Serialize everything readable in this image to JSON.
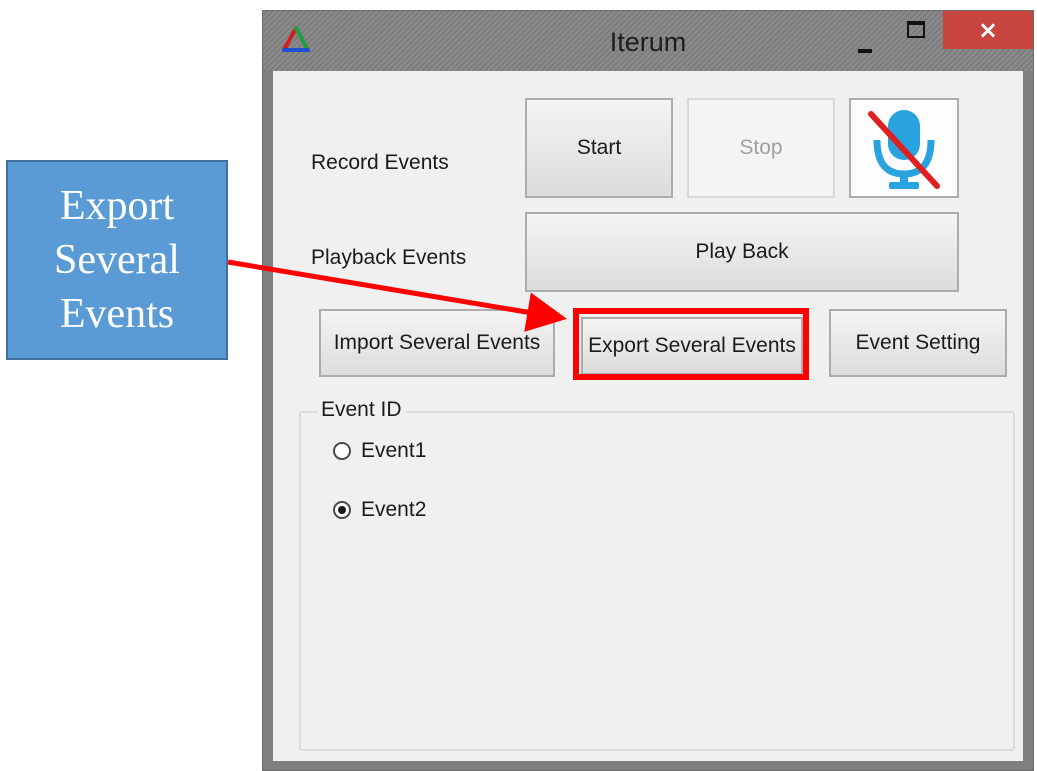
{
  "window": {
    "title": "Iterum",
    "close_glyph": "×"
  },
  "form": {
    "record_label": "Record Events",
    "playback_label": "Playback Events",
    "start_button": "Start",
    "stop_button": "Stop",
    "mic_button_icon": "microphone-muted-icon",
    "play_back_button": "Play Back",
    "import_button": "Import Several Events",
    "export_button": "Export Several Events",
    "event_setting_button": "Event Setting",
    "event_group": {
      "title": "Event ID",
      "options": [
        {
          "label": "Event1",
          "checked": false
        },
        {
          "label": "Event2",
          "checked": true
        }
      ]
    }
  },
  "annotation": {
    "callout_line1": "Export",
    "callout_line2": "Several",
    "callout_line3": "Events",
    "callout_color": "#5b9bd5",
    "highlight_color": "#ff0000"
  },
  "colors": {
    "close_button": "#c8453f",
    "mic_icon": "#29a3e0",
    "mic_slash": "#e02020"
  }
}
